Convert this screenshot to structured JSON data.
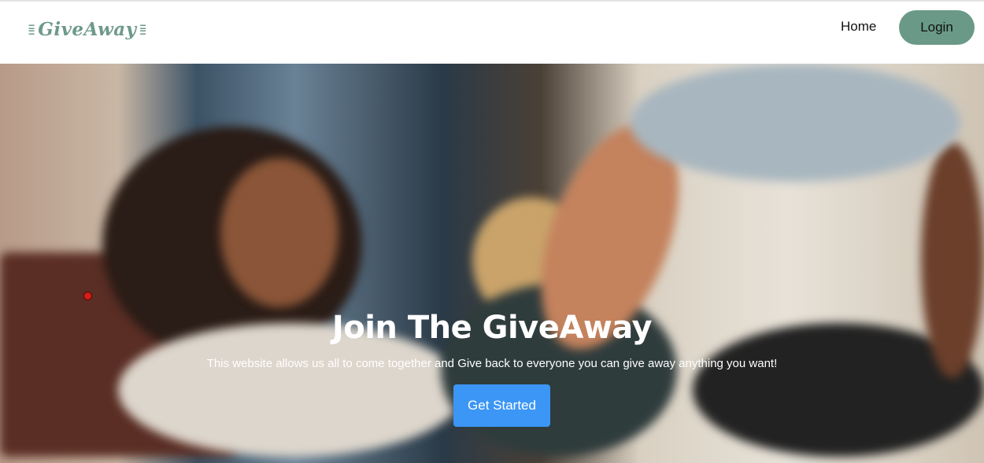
{
  "nav": {
    "logo_text": "GiveAway",
    "links": [
      {
        "label": "Home"
      }
    ],
    "login_label": "Login"
  },
  "hero": {
    "title": "Join The GiveAway",
    "subtitle": "This website allows us all to come together and Give back to everyone you can give away anything you want!",
    "cta_label": "Get Started"
  },
  "colors": {
    "brand": "#6a9a87",
    "cta": "#3b96f5"
  }
}
